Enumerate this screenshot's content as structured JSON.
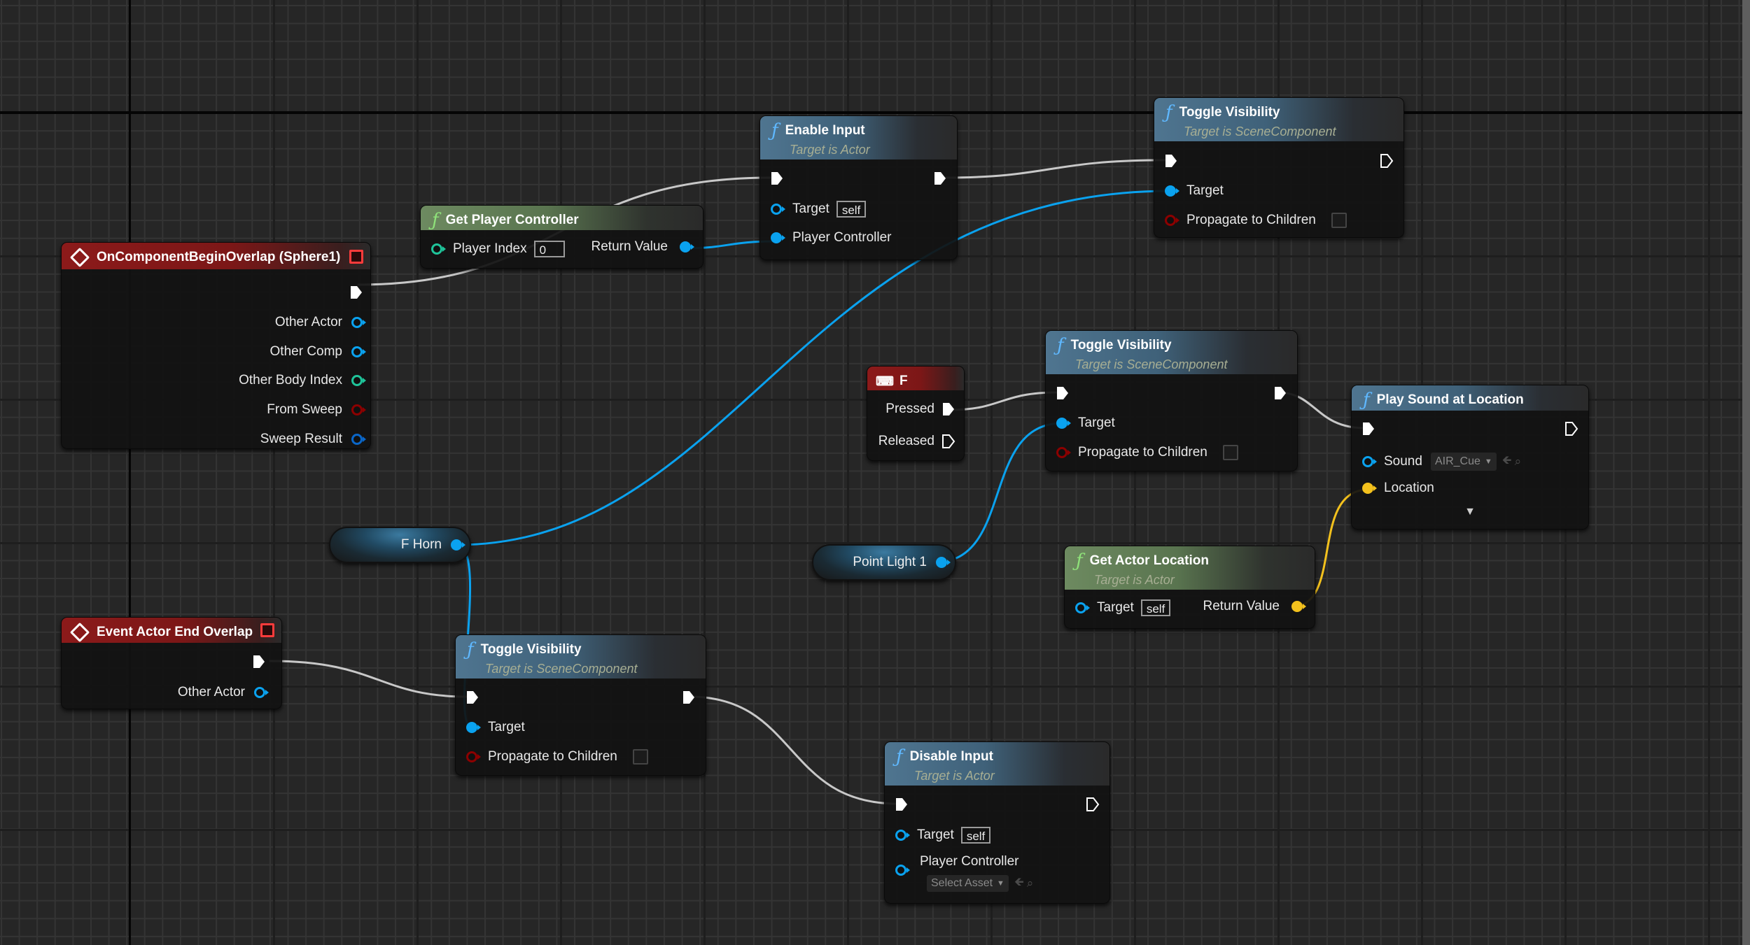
{
  "app": "Blueprint Event Graph",
  "nodes": {
    "begin_overlap": {
      "title": "OnComponentBeginOverlap (Sphere1)",
      "outputs": [
        "Other Actor",
        "Other Comp",
        "Other Body Index",
        "From Sweep",
        "Sweep Result"
      ]
    },
    "get_player_controller": {
      "title": "Get Player Controller",
      "player_index_label": "Player Index",
      "player_index_value": "0",
      "return_label": "Return Value"
    },
    "enable_input": {
      "title": "Enable Input",
      "subtitle": "Target is Actor",
      "target_label": "Target",
      "target_value": "self",
      "player_controller_label": "Player Controller"
    },
    "toggle_vis_top": {
      "title": "Toggle Visibility",
      "subtitle": "Target is SceneComponent",
      "target_label": "Target",
      "propagate_label": "Propagate to Children",
      "propagate_checked": false
    },
    "key_f": {
      "title": "F",
      "pressed_label": "Pressed",
      "released_label": "Released"
    },
    "toggle_vis_mid": {
      "title": "Toggle Visibility",
      "subtitle": "Target is SceneComponent",
      "target_label": "Target",
      "propagate_label": "Propagate to Children",
      "propagate_checked": false
    },
    "play_sound": {
      "title": "Play Sound at Location",
      "sound_label": "Sound",
      "sound_value": "AIR_Cue",
      "location_label": "Location"
    },
    "var_fhorn": {
      "label": "F Horn"
    },
    "var_pointlight": {
      "label": "Point Light 1"
    },
    "get_actor_location": {
      "title": "Get Actor Location",
      "subtitle": "Target is Actor",
      "target_label": "Target",
      "target_value": "self",
      "return_label": "Return Value"
    },
    "end_overlap": {
      "title": "Event Actor End Overlap",
      "other_actor_label": "Other Actor"
    },
    "toggle_vis_bottom": {
      "title": "Toggle Visibility",
      "subtitle": "Target is SceneComponent",
      "target_label": "Target",
      "propagate_label": "Propagate to Children",
      "propagate_checked": false
    },
    "disable_input": {
      "title": "Disable Input",
      "subtitle": "Target is Actor",
      "target_label": "Target",
      "target_value": "self",
      "player_controller_label": "Player Controller",
      "player_controller_value": "Select Asset"
    }
  },
  "colors": {
    "exec_wire": "#c8c8c8",
    "object_wire": "#0aa2ef",
    "vector_wire": "#f3c11d",
    "event_header": "#8c1a1a",
    "function_header": "#4f7590",
    "pure_header": "#6d8a60"
  }
}
